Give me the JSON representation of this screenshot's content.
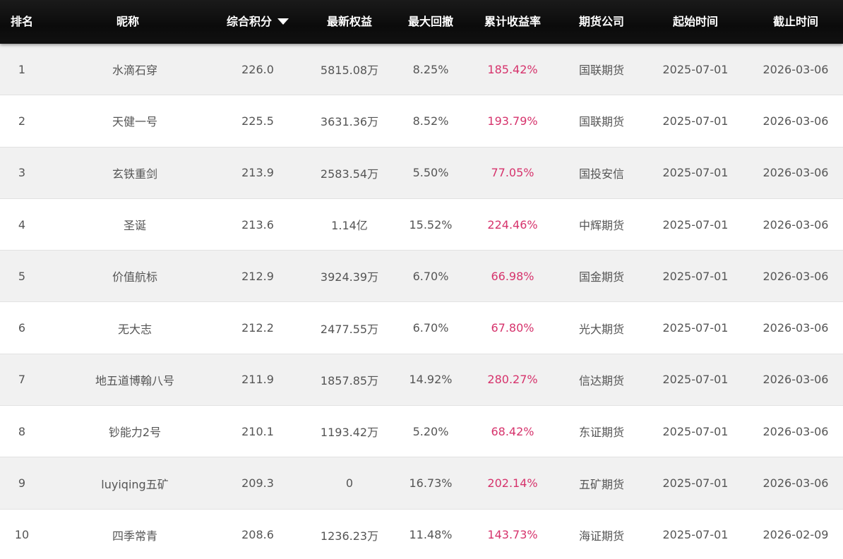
{
  "table": {
    "headers": {
      "rank": "排名",
      "nickname": "昵称",
      "score": "综合积分",
      "equity": "最新权益",
      "drawdown": "最大回撤",
      "return": "累计收益率",
      "broker": "期货公司",
      "start": "起始时间",
      "end": "截止时间"
    },
    "sort_icon": "triangle-down-icon",
    "colors": {
      "header_bg": "#111111",
      "row_alt_bg": "#f1f1f1",
      "return_text": "#d6336c",
      "body_text": "#555555"
    },
    "rows": [
      {
        "rank": "1",
        "nickname": "水滴石穿",
        "score": "226.0",
        "equity": "5815.08万",
        "drawdown": "8.25%",
        "return": "185.42%",
        "broker": "国联期货",
        "start": "2025-07-01",
        "end": "2026-03-06"
      },
      {
        "rank": "2",
        "nickname": "天健一号",
        "score": "225.5",
        "equity": "3631.36万",
        "drawdown": "8.52%",
        "return": "193.79%",
        "broker": "国联期货",
        "start": "2025-07-01",
        "end": "2026-03-06"
      },
      {
        "rank": "3",
        "nickname": "玄铁重剑",
        "score": "213.9",
        "equity": "2583.54万",
        "drawdown": "5.50%",
        "return": "77.05%",
        "broker": "国投安信",
        "start": "2025-07-01",
        "end": "2026-03-06"
      },
      {
        "rank": "4",
        "nickname": "圣诞",
        "score": "213.6",
        "equity": "1.14亿",
        "drawdown": "15.52%",
        "return": "224.46%",
        "broker": "中辉期货",
        "start": "2025-07-01",
        "end": "2026-03-06"
      },
      {
        "rank": "5",
        "nickname": "价值航标",
        "score": "212.9",
        "equity": "3924.39万",
        "drawdown": "6.70%",
        "return": "66.98%",
        "broker": "国金期货",
        "start": "2025-07-01",
        "end": "2026-03-06"
      },
      {
        "rank": "6",
        "nickname": "无大志",
        "score": "212.2",
        "equity": "2477.55万",
        "drawdown": "6.70%",
        "return": "67.80%",
        "broker": "光大期货",
        "start": "2025-07-01",
        "end": "2026-03-06"
      },
      {
        "rank": "7",
        "nickname": "地五道博翰八号",
        "score": "211.9",
        "equity": "1857.85万",
        "drawdown": "14.92%",
        "return": "280.27%",
        "broker": "信达期货",
        "start": "2025-07-01",
        "end": "2026-03-06"
      },
      {
        "rank": "8",
        "nickname": "钞能力2号",
        "score": "210.1",
        "equity": "1193.42万",
        "drawdown": "5.20%",
        "return": "68.42%",
        "broker": "东证期货",
        "start": "2025-07-01",
        "end": "2026-03-06"
      },
      {
        "rank": "9",
        "nickname": "luyiqing五矿",
        "score": "209.3",
        "equity": "0",
        "drawdown": "16.73%",
        "return": "202.14%",
        "broker": "五矿期货",
        "start": "2025-07-01",
        "end": "2026-03-06"
      },
      {
        "rank": "10",
        "nickname": "四季常青",
        "score": "208.6",
        "equity": "1236.23万",
        "drawdown": "11.48%",
        "return": "143.73%",
        "broker": "海证期货",
        "start": "2025-07-01",
        "end": "2026-02-09"
      }
    ]
  }
}
